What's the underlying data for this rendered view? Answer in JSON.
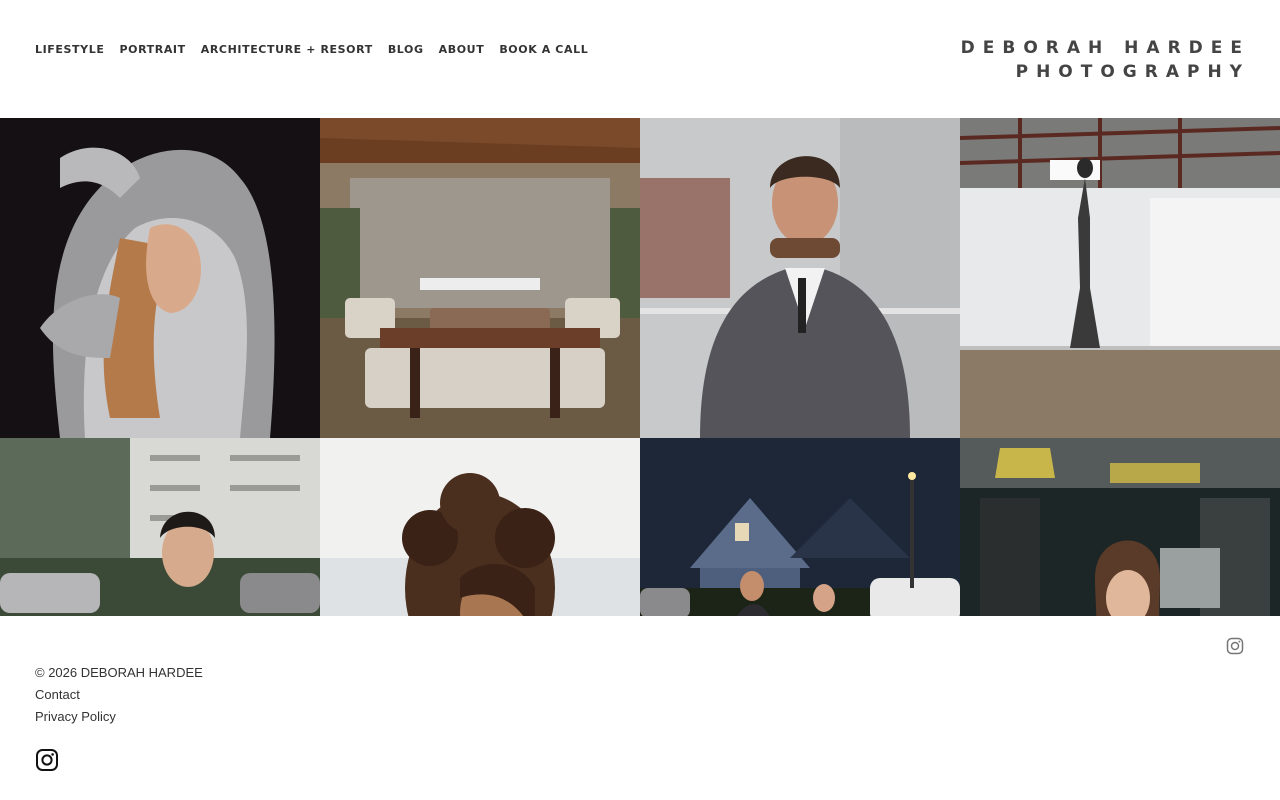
{
  "nav": {
    "items": [
      {
        "label": "LIFESTYLE"
      },
      {
        "label": "PORTRAIT"
      },
      {
        "label": "ARCHITECTURE + RESORT"
      },
      {
        "label": "BLOG"
      },
      {
        "label": "ABOUT"
      },
      {
        "label": "BOOK A CALL"
      }
    ]
  },
  "brand": {
    "line1": "DEBORAH HARDEE",
    "line2": "PHOTOGRAPHY"
  },
  "gallery": {
    "photos": [
      {
        "subject": "woman in silver hoodie"
      },
      {
        "subject": "modern living room with fireplace"
      },
      {
        "subject": "man in grey suit"
      },
      {
        "subject": "dancer in empty loft"
      },
      {
        "subject": "woman in white sweater on street"
      },
      {
        "subject": "curly haired woman at beach"
      },
      {
        "subject": "couple at night by house"
      },
      {
        "subject": "woman in server room"
      }
    ]
  },
  "footer": {
    "copyright": "© 2026 DEBORAH HARDEE",
    "contact": "Contact",
    "privacy": "Privacy Policy"
  },
  "icons": {
    "instagram_top": "instagram-icon",
    "instagram_bottom": "instagram-icon"
  }
}
